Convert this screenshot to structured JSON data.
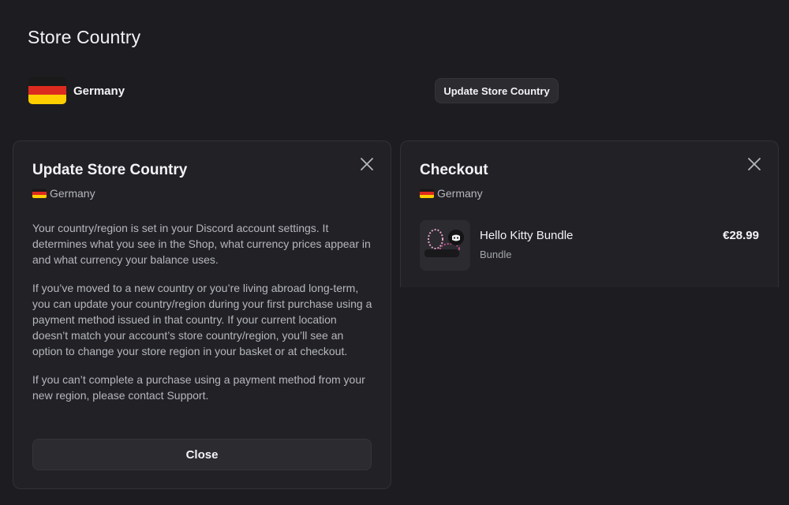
{
  "store": {
    "title": "Store Country",
    "country": "Germany",
    "update_button": "Update Store Country"
  },
  "update_modal": {
    "title": "Update Store Country",
    "country": "Germany",
    "paragraphs": [
      "Your country/region is set in your Discord account settings. It determines what you see in the Shop, what currency prices appear in and what currency your balance uses.",
      "If you’ve moved to a new country or you’re living abroad long-term, you can update your country/region during your first purchase using a payment method issued in that country. If your current location doesn’t match your account’s store country/region, you’ll see an option to change your store region in your basket or at checkout.",
      "If you can’t complete a purchase using a payment method from your new region, please contact Support."
    ],
    "close_button": "Close",
    "close_icon": "close-icon"
  },
  "checkout_modal": {
    "title": "Checkout",
    "country": "Germany",
    "item": {
      "name": "Hello Kitty Bundle",
      "type": "Bundle",
      "price": "€28.99"
    },
    "close_icon": "close-icon"
  },
  "colors": {
    "background": "#1d1d21",
    "modal": "#222226",
    "button": "#2b2b30",
    "flag_black": "#1a1a1a",
    "flag_red": "#dd2a1f",
    "flag_gold": "#ffce00"
  }
}
